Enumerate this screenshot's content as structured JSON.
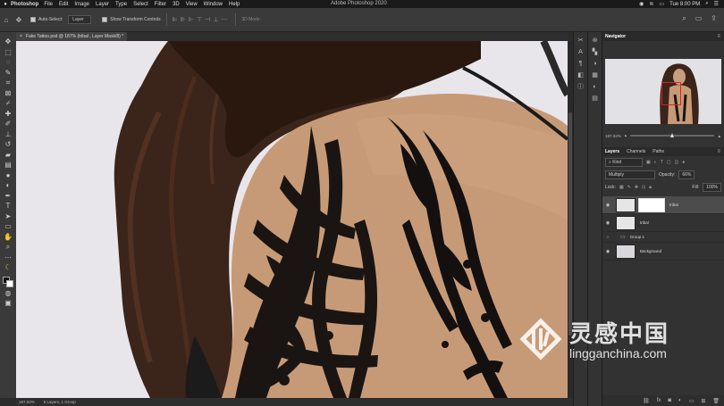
{
  "menubar": {
    "app": "Photoshop",
    "items": [
      "File",
      "Edit",
      "Image",
      "Layer",
      "Type",
      "Select",
      "Filter",
      "3D",
      "View",
      "Window",
      "Help"
    ],
    "center_title": "Adobe Photoshop 2020",
    "clock": "Tue 8:00 PM"
  },
  "options": {
    "auto_select_label": "Auto-Select:",
    "auto_select_value": "Layer",
    "show_transform_label": "Show Transform Controls",
    "mode_3d": "3D Mode:"
  },
  "document": {
    "tab_title": "Fake Tattoo.psd @ 187% (tribal , Layer Mask/8) *",
    "close_glyph": "×"
  },
  "status": {
    "zoom": "187.02%",
    "info": "5 Layers, 1 Group"
  },
  "navigator": {
    "title": "Navigator",
    "zoom": "187.02%"
  },
  "layers_panel": {
    "tabs": [
      "Layers",
      "Channels",
      "Paths"
    ],
    "filter": "Kind",
    "blend_mode": "Multiply",
    "opacity_label": "Opacity:",
    "opacity_value": "66%",
    "lock_label": "Lock:",
    "fill_label": "Fill:",
    "fill_value": "100%",
    "layers": [
      {
        "name": "tribal",
        "selected": true,
        "has_mask": true
      },
      {
        "name": "tribal",
        "selected": false,
        "has_mask": false
      },
      {
        "name": "Group 1",
        "group": true
      },
      {
        "name": "Background",
        "selected": false,
        "has_mask": false
      }
    ]
  },
  "watermark": {
    "chinese": "灵感中国",
    "url": "lingganchina.com"
  },
  "colors": {
    "ui_dark": "#2b2b2b",
    "panel": "#323232",
    "canvas_bg": "#e7e5ea",
    "skin": "#c79a77",
    "hair": "#3b2419",
    "tattoo": "#1a1512",
    "nav_box": "#e02020"
  }
}
